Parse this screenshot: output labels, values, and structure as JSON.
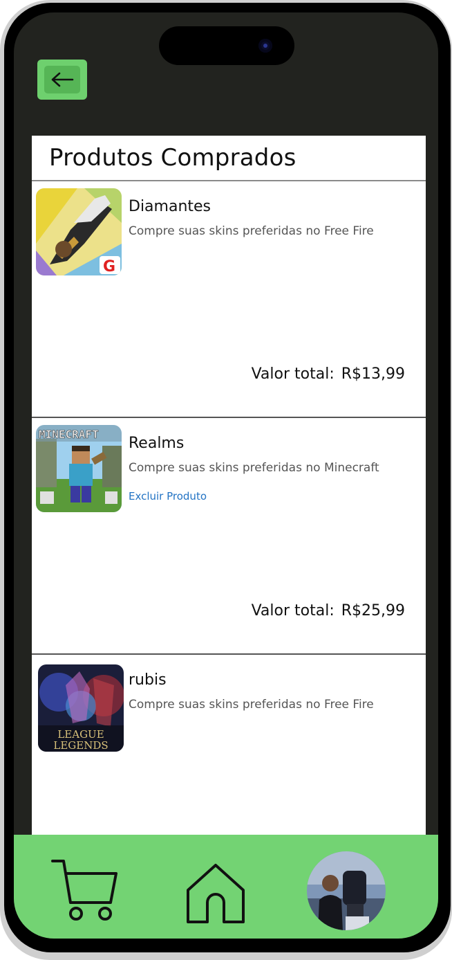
{
  "header": {
    "back_icon": "arrow-left-icon",
    "title": "Produtos Comprados"
  },
  "products": [
    {
      "name": "Diamantes",
      "description": "Compre suas skins preferidas no Free Fire",
      "total_label": "Valor total:",
      "total_value": "R$13,99",
      "image": "free-fire-game-art"
    },
    {
      "name": "Realms",
      "description": "Compre suas skins preferidas no Minecraft",
      "action": "Excluir Produto",
      "total_label": "Valor total:",
      "total_value": "R$25,99",
      "image": "minecraft-game-art",
      "image_text": "MINECRAFT"
    },
    {
      "name": "rubis",
      "description": "Compre suas skins preferidas no Free Fire",
      "image": "league-of-legends-game-art",
      "image_text_line1": "LEAGUE",
      "image_text_line2": "LEGENDS"
    }
  ],
  "bottom_nav": {
    "items": [
      {
        "icon": "cart-icon"
      },
      {
        "icon": "home-icon"
      },
      {
        "icon": "profile-avatar"
      }
    ]
  },
  "colors": {
    "accent_green": "#73d373",
    "frame_dark": "#22231f",
    "link_blue": "#2273c4"
  }
}
